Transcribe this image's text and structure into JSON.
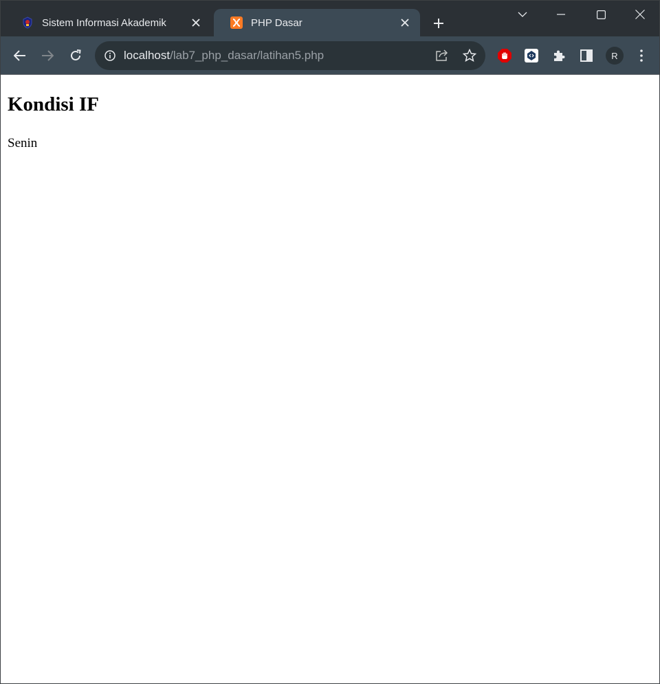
{
  "browser": {
    "tabs": [
      {
        "title": "Sistem Informasi Akademik",
        "favicon": "university-logo-icon",
        "active": false
      },
      {
        "title": "PHP Dasar",
        "favicon": "xampp-icon",
        "active": true
      }
    ],
    "address": {
      "host": "localhost",
      "path": "/lab7_php_dasar/latihan5.php"
    },
    "profile_initial": "R",
    "colors": {
      "tabstrip": "#2b3035",
      "toolbar": "#3c4a55",
      "omnibox": "#2a3338",
      "text": "#e8eaed"
    }
  },
  "page": {
    "heading": "Kondisi IF",
    "paragraph": "Senin"
  }
}
